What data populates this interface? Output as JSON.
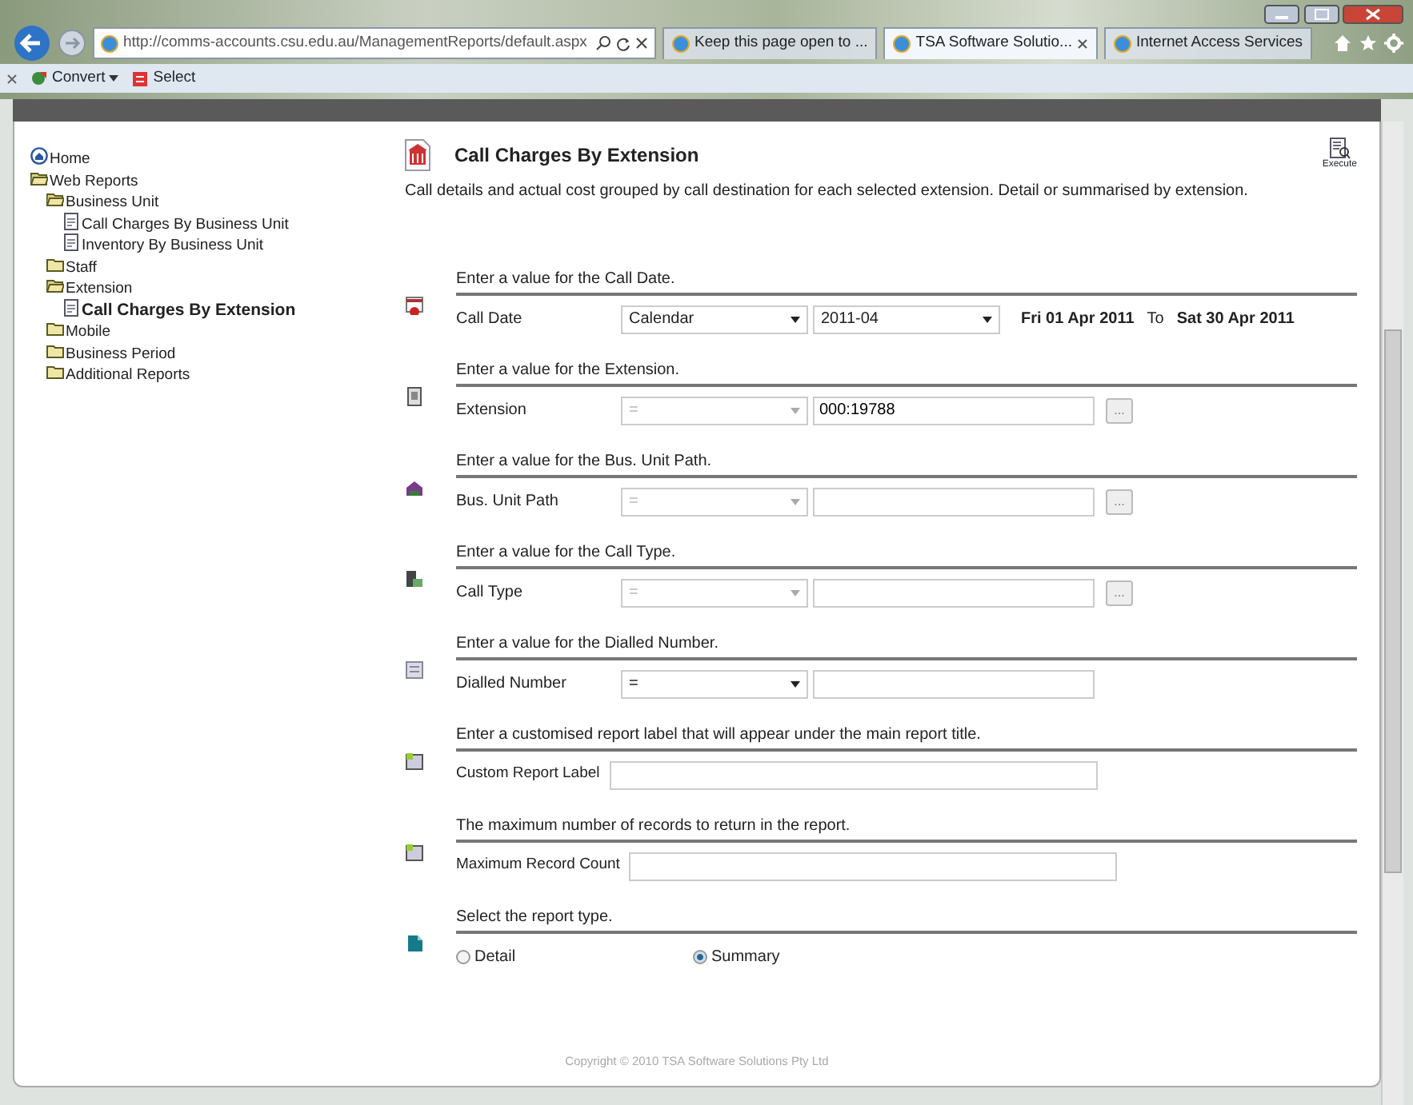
{
  "browser": {
    "address": "http://comms-accounts.csu.edu.au/ManagementReports/default.aspx",
    "tabs": [
      {
        "label": "Keep this page open to ...",
        "selected": false
      },
      {
        "label": "TSA Software Solutio...",
        "selected": true
      },
      {
        "label": "Internet Access Services",
        "selected": false
      }
    ],
    "command_bar": [
      "Convert",
      "Select"
    ]
  },
  "tree": [
    {
      "kind": "home",
      "label": "Home"
    },
    {
      "kind": "folder",
      "label": "Web Reports",
      "expanded": true,
      "children": [
        {
          "kind": "folder",
          "label": "Business Unit",
          "expanded": true,
          "children": [
            {
              "kind": "report",
              "label": "Call Charges By Business Unit",
              "selected": false
            },
            {
              "kind": "report",
              "label": "Inventory By Business Unit",
              "selected": false
            }
          ]
        },
        {
          "kind": "folder",
          "label": "Staff",
          "expanded": false
        },
        {
          "kind": "folder",
          "label": "Extension",
          "expanded": true,
          "children": [
            {
              "kind": "report",
              "label": "Call Charges By Extension",
              "selected": true
            }
          ]
        },
        {
          "kind": "folder",
          "label": "Mobile",
          "expanded": false
        },
        {
          "kind": "folder",
          "label": "Business Period",
          "expanded": false
        },
        {
          "kind": "folder",
          "label": "Additional Reports",
          "expanded": false
        }
      ]
    }
  ],
  "report": {
    "title": "Call Charges By Extension",
    "execute_label": "Execute",
    "description": "Call details and actual cost grouped by call destination for each selected extension. Detail or summarised by extension."
  },
  "parameters": [
    {
      "kind": "date",
      "prompt": "Enter a value for the Call Date.",
      "label": "Call Date",
      "period_type": "Calendar",
      "period": "2011-04",
      "from": "Fri 01 Apr 2011",
      "to_word": "To",
      "to": "Sat 30 Apr 2011"
    },
    {
      "kind": "lookup",
      "prompt": "Enter a value for the Extension.",
      "label": "Extension",
      "operator": "=",
      "operator_disabled": true,
      "value": "000:19788",
      "browse_label": "..."
    },
    {
      "kind": "lookup",
      "prompt": "Enter a value for the Bus. Unit Path.",
      "label": "Bus. Unit Path",
      "operator": "=",
      "operator_disabled": true,
      "browse_label": "..."
    },
    {
      "kind": "lookup",
      "prompt": "Enter a value for the Call Type.",
      "label": "Call Type",
      "operator": "=",
      "operator_disabled": true,
      "browse_label": "..."
    },
    {
      "kind": "operator_text",
      "prompt": "Enter a value for the Dialled Number.",
      "label": "Dialled Number",
      "operator": "=",
      "operator_disabled": false
    },
    {
      "kind": "text",
      "prompt": "Enter a customised report label that will appear under the main report title.",
      "label": "Custom Report Label"
    },
    {
      "kind": "text",
      "prompt": "The maximum number of records to return in the report.",
      "label": "Maximum Record Count"
    },
    {
      "kind": "radio",
      "prompt": "Select the report type.",
      "options": [
        {
          "label": "Detail",
          "selected": false
        },
        {
          "label": "Summary",
          "selected": true
        }
      ]
    }
  ],
  "footer": "Copyright © 2010 TSA Software Solutions Pty Ltd"
}
